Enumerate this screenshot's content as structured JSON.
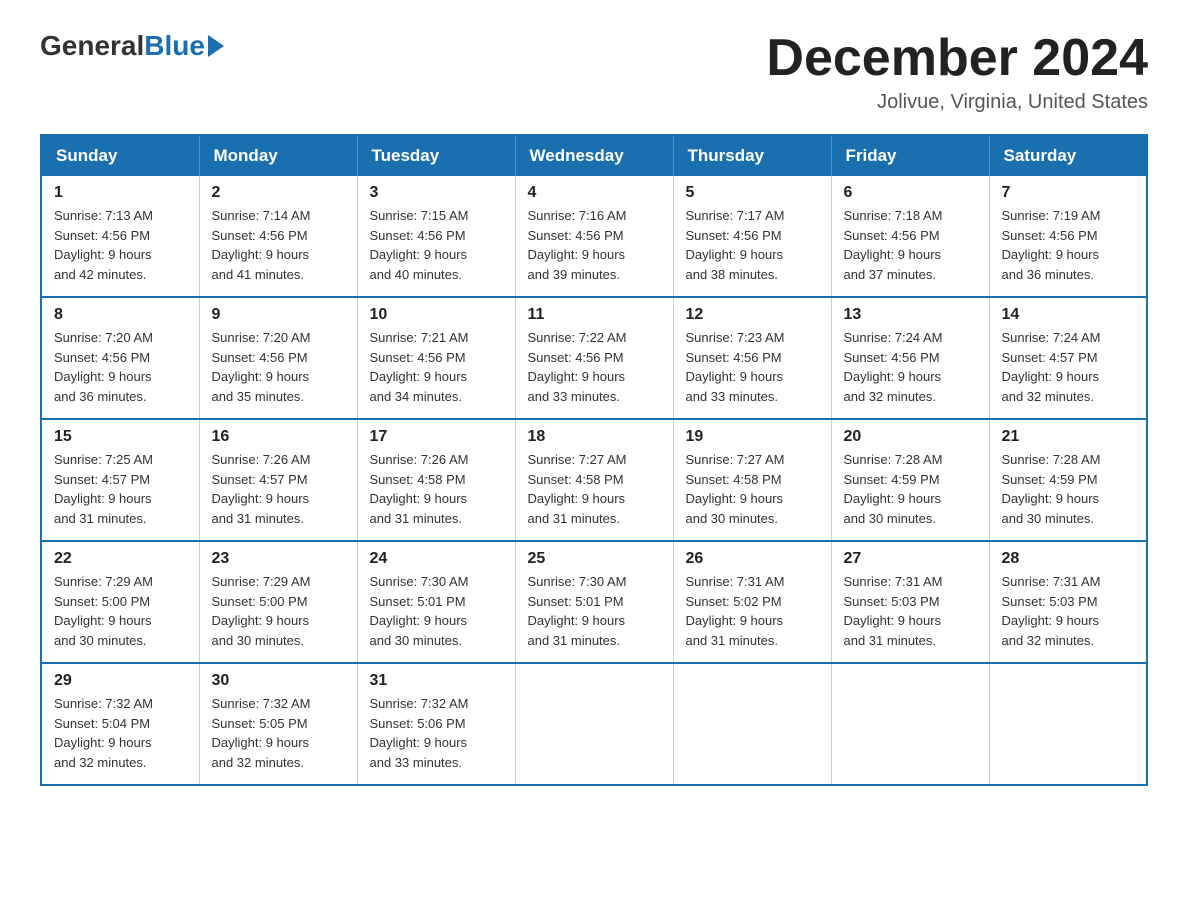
{
  "header": {
    "logo_general": "General",
    "logo_blue": "Blue",
    "month_title": "December 2024",
    "subtitle": "Jolivue, Virginia, United States"
  },
  "weekdays": [
    "Sunday",
    "Monday",
    "Tuesday",
    "Wednesday",
    "Thursday",
    "Friday",
    "Saturday"
  ],
  "weeks": [
    [
      {
        "day": "1",
        "sunrise": "7:13 AM",
        "sunset": "4:56 PM",
        "daylight": "9 hours and 42 minutes."
      },
      {
        "day": "2",
        "sunrise": "7:14 AM",
        "sunset": "4:56 PM",
        "daylight": "9 hours and 41 minutes."
      },
      {
        "day": "3",
        "sunrise": "7:15 AM",
        "sunset": "4:56 PM",
        "daylight": "9 hours and 40 minutes."
      },
      {
        "day": "4",
        "sunrise": "7:16 AM",
        "sunset": "4:56 PM",
        "daylight": "9 hours and 39 minutes."
      },
      {
        "day": "5",
        "sunrise": "7:17 AM",
        "sunset": "4:56 PM",
        "daylight": "9 hours and 38 minutes."
      },
      {
        "day": "6",
        "sunrise": "7:18 AM",
        "sunset": "4:56 PM",
        "daylight": "9 hours and 37 minutes."
      },
      {
        "day": "7",
        "sunrise": "7:19 AM",
        "sunset": "4:56 PM",
        "daylight": "9 hours and 36 minutes."
      }
    ],
    [
      {
        "day": "8",
        "sunrise": "7:20 AM",
        "sunset": "4:56 PM",
        "daylight": "9 hours and 36 minutes."
      },
      {
        "day": "9",
        "sunrise": "7:20 AM",
        "sunset": "4:56 PM",
        "daylight": "9 hours and 35 minutes."
      },
      {
        "day": "10",
        "sunrise": "7:21 AM",
        "sunset": "4:56 PM",
        "daylight": "9 hours and 34 minutes."
      },
      {
        "day": "11",
        "sunrise": "7:22 AM",
        "sunset": "4:56 PM",
        "daylight": "9 hours and 33 minutes."
      },
      {
        "day": "12",
        "sunrise": "7:23 AM",
        "sunset": "4:56 PM",
        "daylight": "9 hours and 33 minutes."
      },
      {
        "day": "13",
        "sunrise": "7:24 AM",
        "sunset": "4:56 PM",
        "daylight": "9 hours and 32 minutes."
      },
      {
        "day": "14",
        "sunrise": "7:24 AM",
        "sunset": "4:57 PM",
        "daylight": "9 hours and 32 minutes."
      }
    ],
    [
      {
        "day": "15",
        "sunrise": "7:25 AM",
        "sunset": "4:57 PM",
        "daylight": "9 hours and 31 minutes."
      },
      {
        "day": "16",
        "sunrise": "7:26 AM",
        "sunset": "4:57 PM",
        "daylight": "9 hours and 31 minutes."
      },
      {
        "day": "17",
        "sunrise": "7:26 AM",
        "sunset": "4:58 PM",
        "daylight": "9 hours and 31 minutes."
      },
      {
        "day": "18",
        "sunrise": "7:27 AM",
        "sunset": "4:58 PM",
        "daylight": "9 hours and 31 minutes."
      },
      {
        "day": "19",
        "sunrise": "7:27 AM",
        "sunset": "4:58 PM",
        "daylight": "9 hours and 30 minutes."
      },
      {
        "day": "20",
        "sunrise": "7:28 AM",
        "sunset": "4:59 PM",
        "daylight": "9 hours and 30 minutes."
      },
      {
        "day": "21",
        "sunrise": "7:28 AM",
        "sunset": "4:59 PM",
        "daylight": "9 hours and 30 minutes."
      }
    ],
    [
      {
        "day": "22",
        "sunrise": "7:29 AM",
        "sunset": "5:00 PM",
        "daylight": "9 hours and 30 minutes."
      },
      {
        "day": "23",
        "sunrise": "7:29 AM",
        "sunset": "5:00 PM",
        "daylight": "9 hours and 30 minutes."
      },
      {
        "day": "24",
        "sunrise": "7:30 AM",
        "sunset": "5:01 PM",
        "daylight": "9 hours and 30 minutes."
      },
      {
        "day": "25",
        "sunrise": "7:30 AM",
        "sunset": "5:01 PM",
        "daylight": "9 hours and 31 minutes."
      },
      {
        "day": "26",
        "sunrise": "7:31 AM",
        "sunset": "5:02 PM",
        "daylight": "9 hours and 31 minutes."
      },
      {
        "day": "27",
        "sunrise": "7:31 AM",
        "sunset": "5:03 PM",
        "daylight": "9 hours and 31 minutes."
      },
      {
        "day": "28",
        "sunrise": "7:31 AM",
        "sunset": "5:03 PM",
        "daylight": "9 hours and 32 minutes."
      }
    ],
    [
      {
        "day": "29",
        "sunrise": "7:32 AM",
        "sunset": "5:04 PM",
        "daylight": "9 hours and 32 minutes."
      },
      {
        "day": "30",
        "sunrise": "7:32 AM",
        "sunset": "5:05 PM",
        "daylight": "9 hours and 32 minutes."
      },
      {
        "day": "31",
        "sunrise": "7:32 AM",
        "sunset": "5:06 PM",
        "daylight": "9 hours and 33 minutes."
      },
      null,
      null,
      null,
      null
    ]
  ],
  "labels": {
    "sunrise": "Sunrise:",
    "sunset": "Sunset:",
    "daylight": "Daylight:"
  }
}
